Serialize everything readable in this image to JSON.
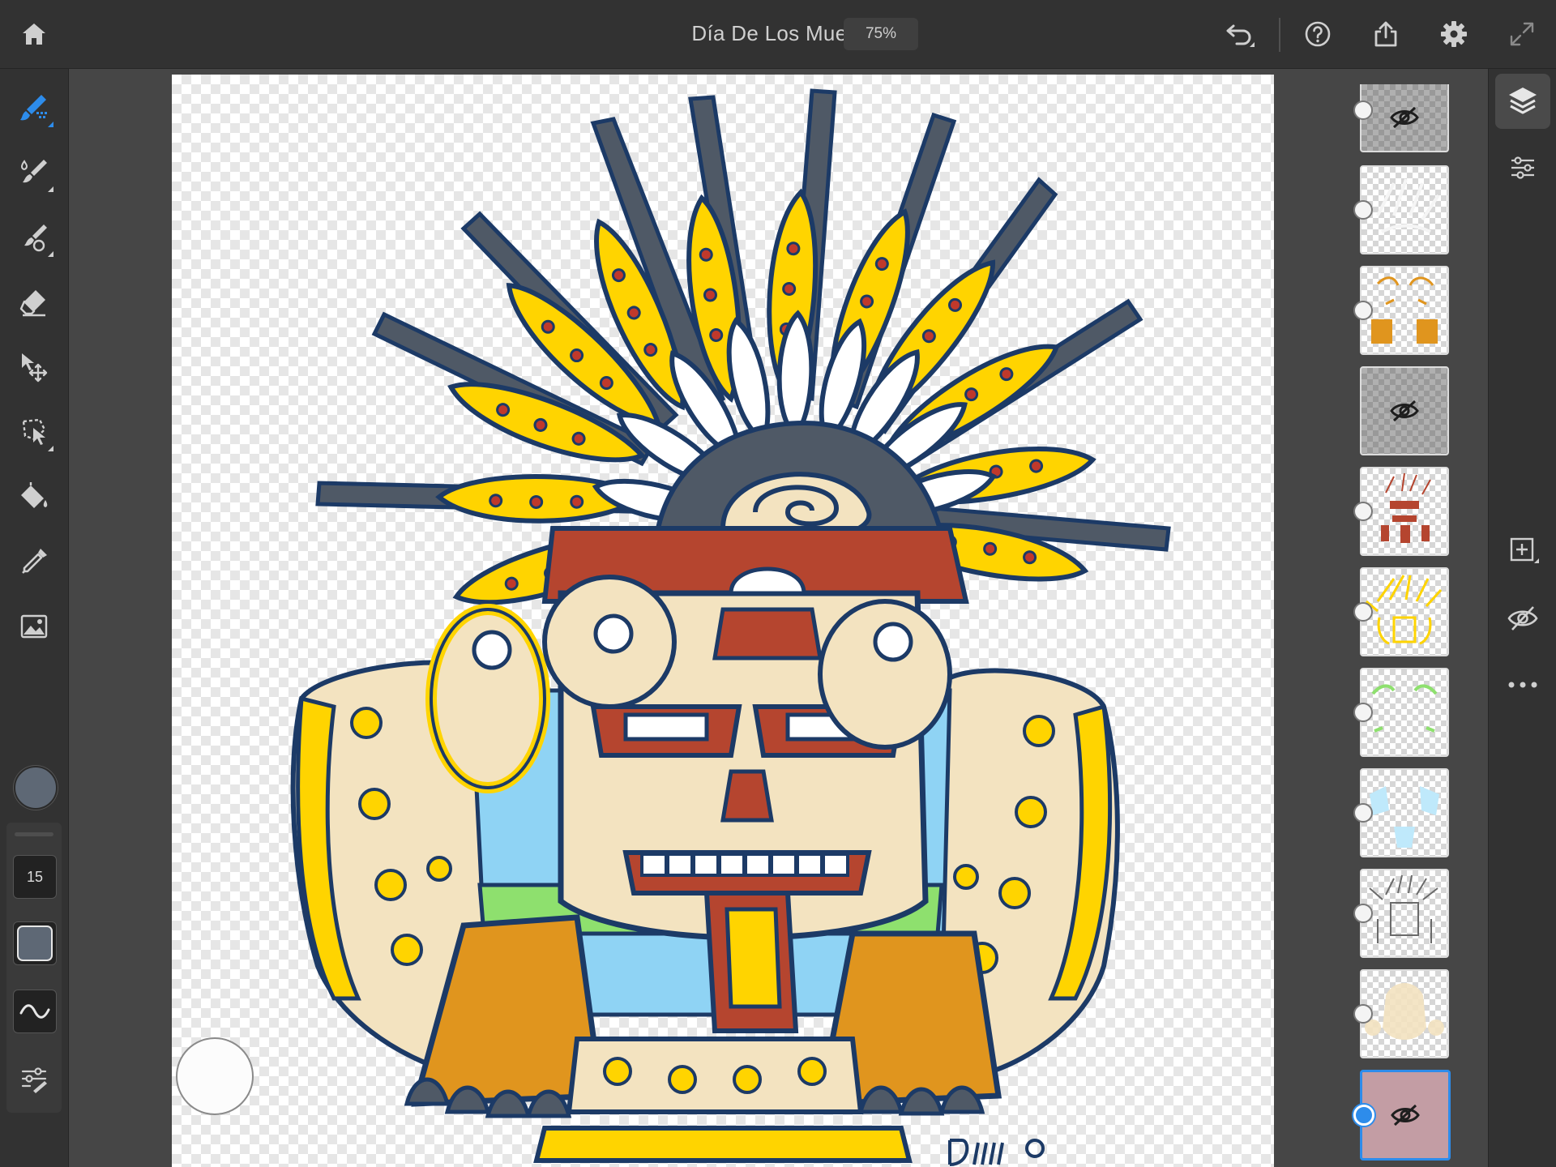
{
  "app": {
    "document_title": "Día De Los Muertos",
    "zoom": "75%"
  },
  "top_bar": {
    "icons": [
      "home-icon",
      "undo-icon",
      "help-icon",
      "share-icon",
      "settings-icon",
      "fullscreen-icon"
    ]
  },
  "left_toolbar": {
    "tools": [
      "paint-brush-tool",
      "pixel-brush-tool",
      "mix-brush-tool",
      "eraser-tool",
      "move-tool",
      "lasso-select-tool",
      "fill-tool",
      "eyedropper-tool",
      "image-tool"
    ],
    "active_tool": "paint-brush-tool",
    "current_color": "#5e6875",
    "brush_size": "15"
  },
  "layers": {
    "count": 11,
    "selected_index": 10
  },
  "right_toolbar": {
    "icons": [
      "layers-icon",
      "layer-properties-icon",
      "add-layer-icon",
      "hide-layer-icon",
      "more-options-icon"
    ]
  },
  "colors": {
    "accent": "#2d8ceb",
    "ui_dark": "#323232",
    "ui_mid": "#464646"
  }
}
